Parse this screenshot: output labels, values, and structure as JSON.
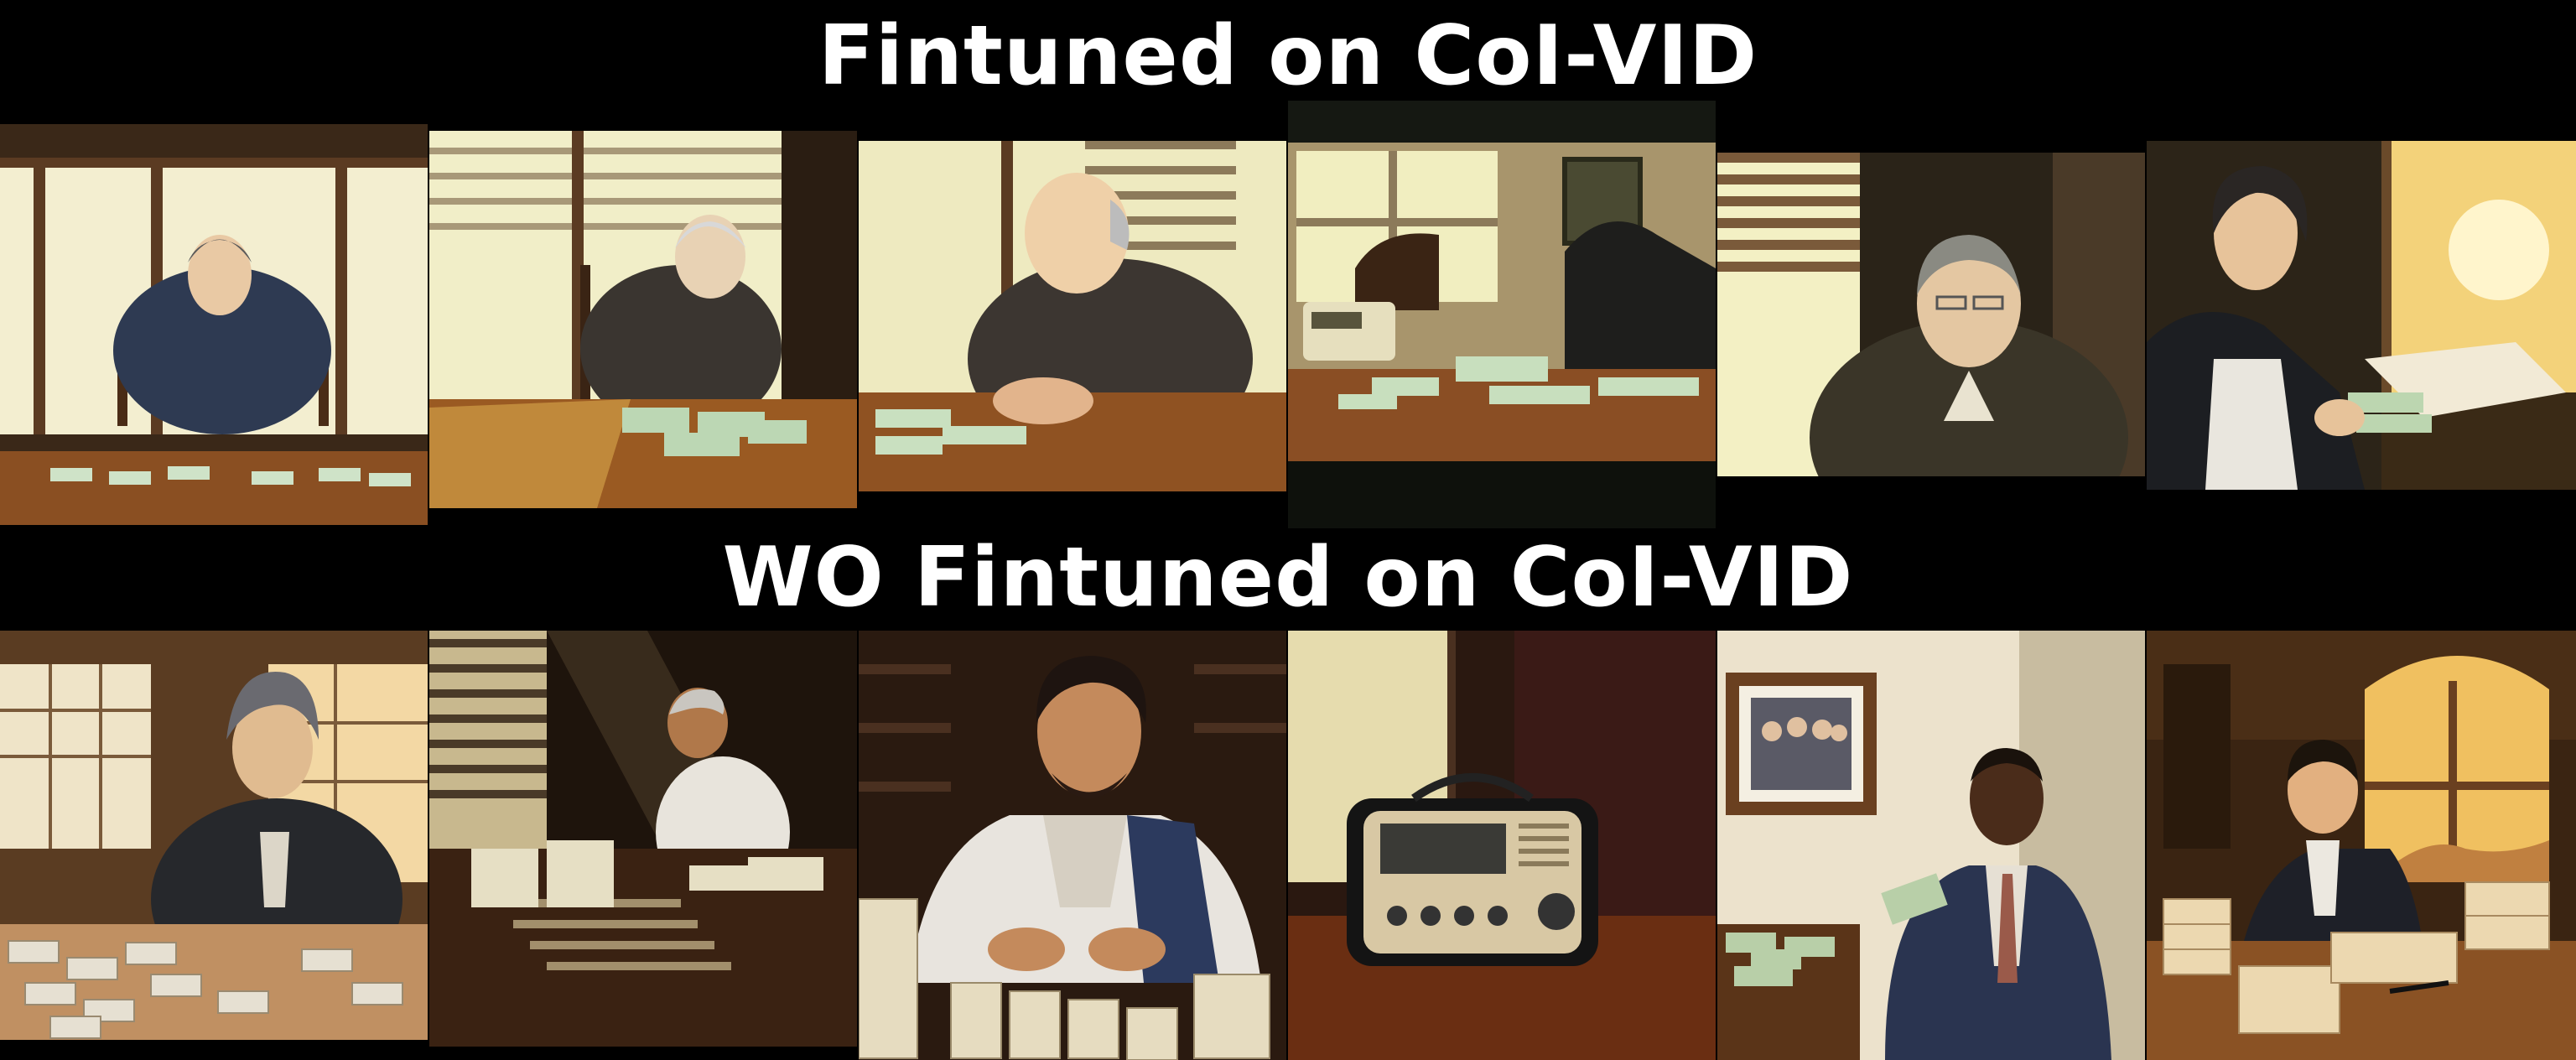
{
  "titles": {
    "top": "Fintuned on CoI-VID",
    "bottom": "WO Fintuned on CoI-VID"
  },
  "rows": {
    "top": {
      "style": "anime",
      "panels": [
        "elderly-man-at-table-with-money",
        "elderly-man-counting-money",
        "elderly-man-counting-money-closeup",
        "radio-and-money-on-table",
        "elderly-man-with-glasses",
        "man-handing-money-sunset"
      ]
    },
    "bottom": {
      "style": "realistic",
      "panels": [
        "man-counting-banknotes-on-table",
        "man-stacking-money-by-window",
        "man-stacking-coins",
        "vintage-radio-on-table",
        "man-holding-money-by-photo",
        "man-writing-at-desk-sunset"
      ]
    }
  },
  "colors": {
    "background": "#000000",
    "title": "#ffffff"
  }
}
